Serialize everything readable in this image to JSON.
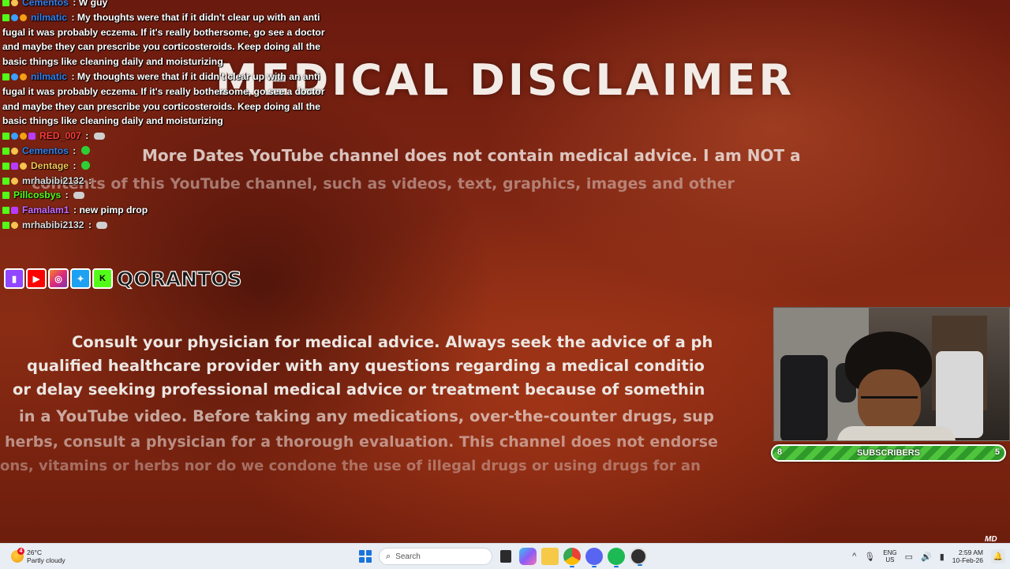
{
  "video": {
    "title": "MEDICAL DISCLAIMER",
    "top_line1": "More Dates YouTube channel does not contain medical advice. I am NOT a",
    "top_line2": "contents of this YouTube channel, such as videos, text, graphics, images and other",
    "body_lines": [
      "Consult your physician for medical advice. Always seek the advice of a ph",
      "qualified healthcare provider with any questions regarding a medical conditio",
      "or delay seeking professional medical advice or treatment because of somethin",
      "in a YouTube video. Before taking any medications, over-the-counter drugs, sup",
      "herbs, consult a physician for a thorough evaluation. This channel does not endorse",
      "ons, vitamins or herbs nor do we condone the use of illegal drugs or using drugs for an"
    ]
  },
  "chat": {
    "messages": [
      {
        "badges": [
          "kick",
          "moon"
        ],
        "user": "Cementos",
        "user_color": "#2f80ed",
        "sep": " : ",
        "text": "W guy"
      },
      {
        "badges": [
          "kick",
          "gem",
          "coin"
        ],
        "user": "nilmatic",
        "user_color": "#2f80ed",
        "sep": " : ",
        "text": "My thoughts were that if it didn't clear up with an anti fugal it was probably eczema. If it's really bothersome, go see a doctor and maybe they can prescribe you corticosteroids. Keep doing all the basic things like cleaning daily and moisturizing"
      },
      {
        "badges": [
          "kick",
          "gem",
          "coin"
        ],
        "user": "nilmatic",
        "user_color": "#2f80ed",
        "sep": " : ",
        "text": "My thoughts were that if it didn't clear up with an anti fugal it was probably eczema. If it's really bothersome, go see a doctor and maybe they can prescribe you corticosteroids. Keep doing all the basic things like cleaning daily and moisturizing"
      },
      {
        "badges": [
          "kick",
          "gem",
          "coin",
          "pink"
        ],
        "user": "RED_007",
        "user_color": "#ff3b3b",
        "sep": " : ",
        "text": "",
        "emote": "grey"
      },
      {
        "badges": [
          "kick",
          "moon"
        ],
        "user": "Cementos",
        "user_color": "#2f80ed",
        "sep": " : ",
        "text": "",
        "emote": "green"
      },
      {
        "badges": [
          "kick",
          "pink",
          "moon"
        ],
        "user": "Dentage",
        "user_color": "#f5c451",
        "sep": " : ",
        "text": "",
        "emote": "green"
      },
      {
        "badges": [
          "kick",
          "moon"
        ],
        "user": "mrhabibi2132",
        "user_color": "#dddddd",
        "sep": " : ",
        "text": ""
      },
      {
        "badges": [
          "kick"
        ],
        "user": "Pillcosbys",
        "user_color": "#53fc18",
        "sep": " : ",
        "text": "",
        "emote": "grey"
      },
      {
        "badges": [
          "kick",
          "pink"
        ],
        "user": "Famalam1",
        "user_color": "#c86bff",
        "sep": " : ",
        "text": "new pimp drop"
      },
      {
        "badges": [
          "kick",
          "moon"
        ],
        "user": "mrhabibi2132",
        "user_color": "#dddddd",
        "sep": " : ",
        "text": "",
        "emote": "grey"
      }
    ]
  },
  "social": {
    "icons": [
      "twitch-icon",
      "youtube-icon",
      "instagram-icon",
      "twitter-icon",
      "kick-icon"
    ],
    "handle": "QORANTOS"
  },
  "subscribers": {
    "label": "SUBSCRIBERS",
    "current": "8",
    "goal": "5"
  },
  "watermark": "MD",
  "taskbar": {
    "weather_temp": "26°C",
    "weather_desc": "Partly cloudy",
    "weather_badge": "4",
    "search_placeholder": "Search",
    "lang_top": "ENG",
    "lang_bottom": "US",
    "time": "2:59 AM",
    "date": "10-Feb-26",
    "accent": "#1a73d9"
  }
}
